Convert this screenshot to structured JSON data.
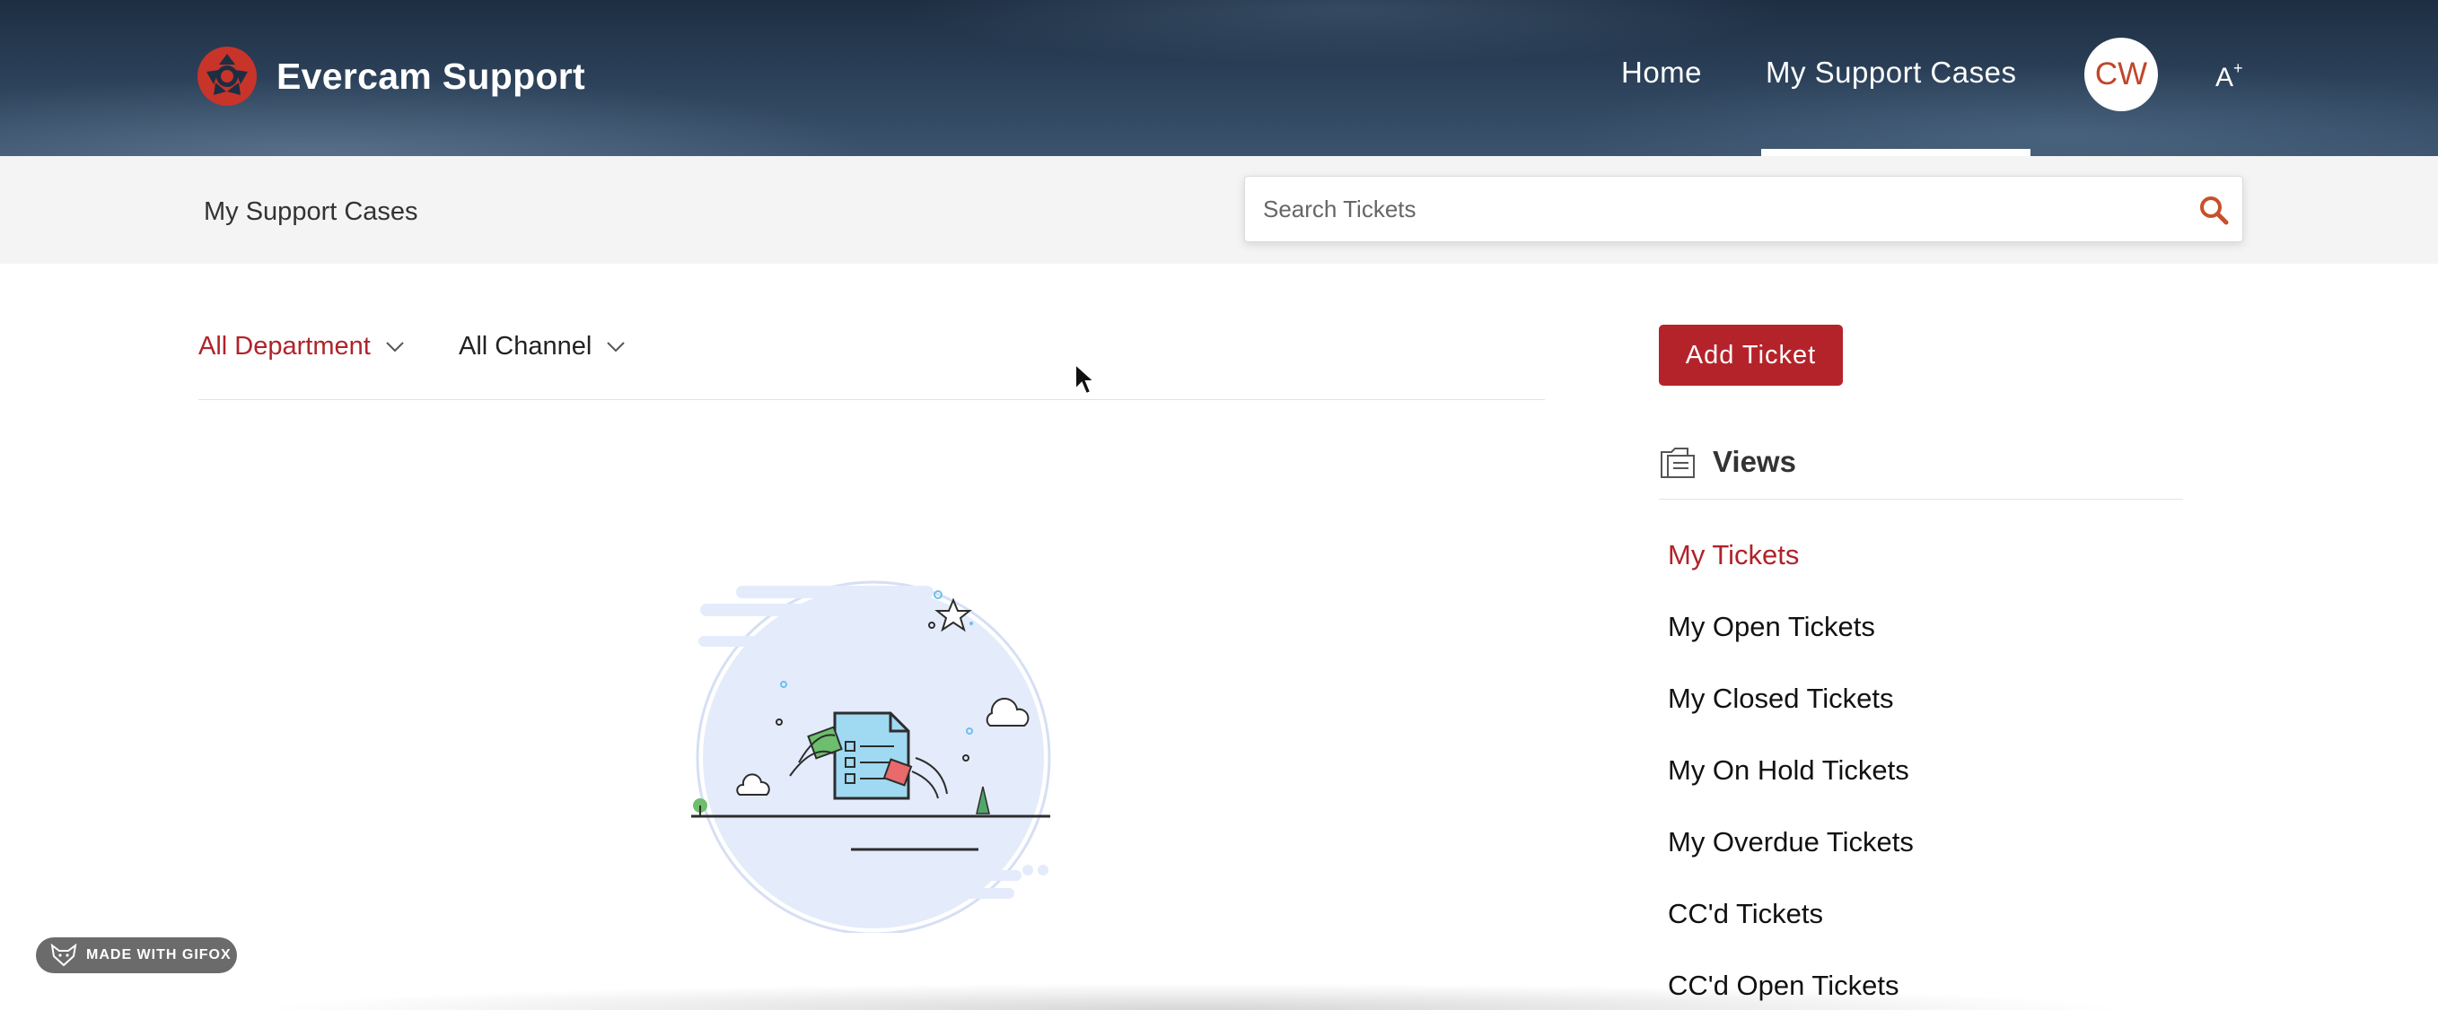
{
  "header": {
    "brand": "Evercam Support",
    "nav": [
      {
        "label": "Home"
      },
      {
        "label": "My Support Cases"
      }
    ],
    "avatar_initials": "CW",
    "accent_color": "#b5232a"
  },
  "subheader": {
    "title": "My Support Cases",
    "search_placeholder": "Search Tickets"
  },
  "filters": {
    "department": "All Department",
    "channel": "All Channel"
  },
  "sidebar": {
    "add_ticket_label": "Add Ticket",
    "views_title": "Views",
    "views": [
      {
        "label": "My Tickets",
        "active": true
      },
      {
        "label": "My Open Tickets"
      },
      {
        "label": "My Closed Tickets"
      },
      {
        "label": "My On Hold Tickets"
      },
      {
        "label": "My Overdue Tickets"
      },
      {
        "label": "CC'd Tickets"
      },
      {
        "label": "CC'd Open Tickets"
      }
    ]
  },
  "badge": {
    "label": "MADE WITH GIFOX"
  }
}
